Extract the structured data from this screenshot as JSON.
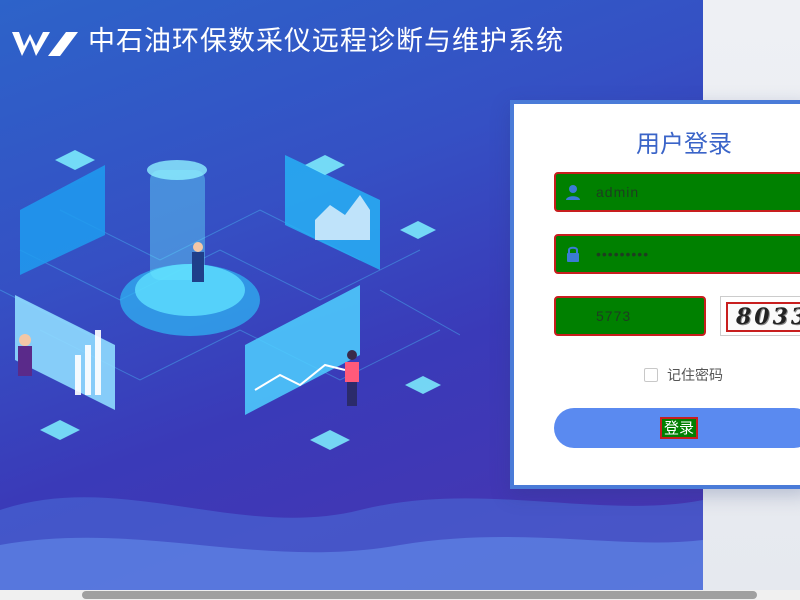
{
  "header": {
    "title": "中石油环保数采仪远程诊断与维护系统",
    "logo_icon": "wv-logo-icon"
  },
  "login": {
    "title": "用户登录",
    "username_value": "admin",
    "password_value": "•••••••••",
    "captcha_input_value": "5773",
    "captcha_image_text": "8033",
    "remember_label": "记住密码",
    "submit_label": "登录"
  },
  "colors": {
    "accent": "#3a64c8",
    "button": "#5a8af0",
    "field_bg": "#008000",
    "field_border": "#c81e1e"
  }
}
